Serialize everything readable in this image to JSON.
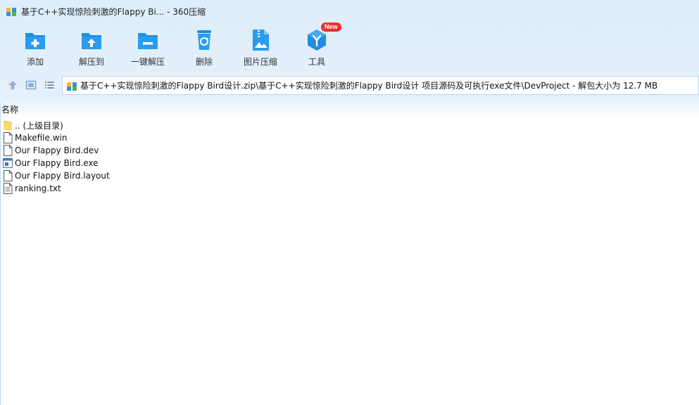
{
  "window": {
    "title": "基于C++实现惊险刺激的Flappy Bi... - 360压缩"
  },
  "toolbar": {
    "items": [
      {
        "label": "添加",
        "icon": "add-folder-icon"
      },
      {
        "label": "解压到",
        "icon": "extract-to-icon"
      },
      {
        "label": "一键解压",
        "icon": "one-click-extract-icon"
      },
      {
        "label": "删除",
        "icon": "recycle-bin-icon"
      },
      {
        "label": "图片压缩",
        "icon": "image-compress-icon"
      },
      {
        "label": "工具",
        "icon": "tools-icon",
        "badge": "New"
      }
    ]
  },
  "address": {
    "path": "基于C++实现惊险刺激的Flappy Bird设计.zip\\基于C++实现惊险刺激的Flappy Bird设计 项目源码及可执行exe文件\\DevProject - 解包大小为 12.7 MB"
  },
  "list": {
    "column_name": "名称",
    "files": [
      {
        "name": ".. (上级目录)",
        "type": "folder"
      },
      {
        "name": "Makefile.win",
        "type": "file"
      },
      {
        "name": "Our Flappy Bird.dev",
        "type": "file"
      },
      {
        "name": "Our Flappy Bird.exe",
        "type": "exe"
      },
      {
        "name": "Our Flappy Bird.layout",
        "type": "file"
      },
      {
        "name": "ranking.txt",
        "type": "text"
      }
    ]
  },
  "colors": {
    "accent": "#1e8ee6",
    "chrome_bg": "#e2effb",
    "badge": "#e8312f"
  }
}
